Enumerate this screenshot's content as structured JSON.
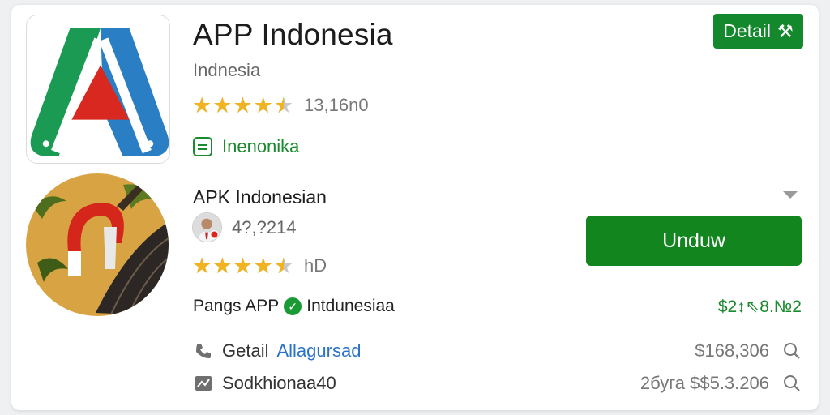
{
  "app": {
    "title": "APP Indonesia",
    "subtitle": "Indnesia",
    "rating_text": "13,16n0",
    "rating_value": 4.5,
    "category": "Inenonika",
    "detail_label": "Detail"
  },
  "apk": {
    "title": "APK Indonesian",
    "dev_count": "4?,?214",
    "rating_text": "hD",
    "rating_value": 4.5,
    "download_label": "Unduw",
    "pangs_left": "Pangs APP",
    "pangs_right": "Intdunesiaa",
    "pangs_price": "$2↕⇖8.№2"
  },
  "info_rows": [
    {
      "icon": "phone-icon",
      "label": "Getail",
      "link": "Allagursad",
      "right_text": "$168,306"
    },
    {
      "icon": "chart-icon",
      "label": "Sodkhionaa40",
      "link": "",
      "right_text": "2буга $$5.3.206"
    }
  ],
  "colors": {
    "accent_green": "#14882c",
    "link_blue": "#2a72c9",
    "star": "#f0b423"
  }
}
